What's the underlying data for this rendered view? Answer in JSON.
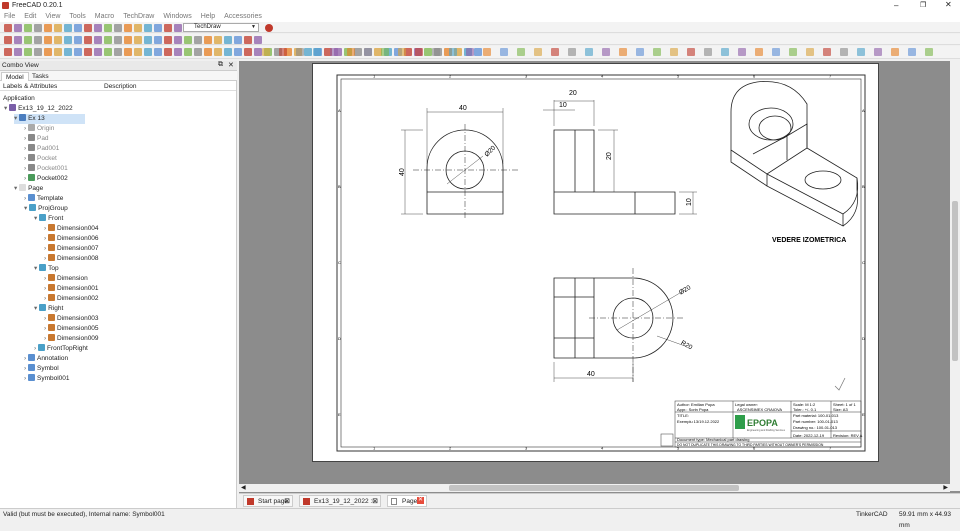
{
  "window": {
    "title": "FreeCAD 0.20.1"
  },
  "menu": [
    "File",
    "Edit",
    "View",
    "Tools",
    "Macro",
    "TechDraw",
    "Windows",
    "Help",
    "Accessories"
  ],
  "workbench": "TechDraw",
  "combo": {
    "title": "Combo View",
    "tabs": [
      "Model",
      "Tasks"
    ],
    "col_labels": "Labels & Attributes",
    "col_desc": "Description",
    "section": "Application"
  },
  "tree": [
    {
      "label": "Ex13_19_12_2022",
      "lvl": 0,
      "color": "#7a5ea8"
    },
    {
      "label": "Ex 13",
      "lvl": 1,
      "color": "#4a7dbf",
      "sel": true
    },
    {
      "label": "Origin",
      "lvl": 2,
      "color": "#aaa",
      "dim": true
    },
    {
      "label": "Pad",
      "lvl": 2,
      "color": "#888",
      "dim": true
    },
    {
      "label": "Pad001",
      "lvl": 2,
      "color": "#888",
      "dim": true
    },
    {
      "label": "Pocket",
      "lvl": 2,
      "color": "#888",
      "dim": true
    },
    {
      "label": "Pocket001",
      "lvl": 2,
      "color": "#888",
      "dim": true
    },
    {
      "label": "Pocket002",
      "lvl": 2,
      "color": "#4a9a5a"
    },
    {
      "label": "Page",
      "lvl": 1,
      "color": "#ddd"
    },
    {
      "label": "Template",
      "lvl": 2,
      "color": "#5a8fd0"
    },
    {
      "label": "ProjGroup",
      "lvl": 2,
      "color": "#4aa0c8"
    },
    {
      "label": "Front",
      "lvl": 3,
      "color": "#4aa0c8"
    },
    {
      "label": "Dimension004",
      "lvl": 4,
      "color": "#c87830"
    },
    {
      "label": "Dimension006",
      "lvl": 4,
      "color": "#c87830"
    },
    {
      "label": "Dimension007",
      "lvl": 4,
      "color": "#c87830"
    },
    {
      "label": "Dimension008",
      "lvl": 4,
      "color": "#c87830"
    },
    {
      "label": "Top",
      "lvl": 3,
      "color": "#4aa0c8"
    },
    {
      "label": "Dimension",
      "lvl": 4,
      "color": "#c87830"
    },
    {
      "label": "Dimension001",
      "lvl": 4,
      "color": "#c87830"
    },
    {
      "label": "Dimension002",
      "lvl": 4,
      "color": "#c87830"
    },
    {
      "label": "Right",
      "lvl": 3,
      "color": "#4aa0c8"
    },
    {
      "label": "Dimension003",
      "lvl": 4,
      "color": "#c87830"
    },
    {
      "label": "Dimension005",
      "lvl": 4,
      "color": "#c87830"
    },
    {
      "label": "Dimension009",
      "lvl": 4,
      "color": "#c87830"
    },
    {
      "label": "FrontTopRight",
      "lvl": 3,
      "color": "#4aa0c8"
    },
    {
      "label": "Annotation",
      "lvl": 2,
      "color": "#5a8fd0"
    },
    {
      "label": "Symbol",
      "lvl": 2,
      "color": "#5a8fd0"
    },
    {
      "label": "Symbol001",
      "lvl": 2,
      "color": "#5a8fd0"
    }
  ],
  "drawing": {
    "dims": {
      "front_w": "40",
      "front_h": "40",
      "front_dia": "Ø20",
      "side_top": "20",
      "side_small": "10",
      "side_h": "20",
      "side_base": "10",
      "top_dia": "Ø20",
      "top_r": "R20",
      "top_w": "40"
    },
    "iso_label": "VEDERE IZOMETRICA",
    "cols": [
      "1",
      "2",
      "3",
      "4",
      "5",
      "6",
      "7"
    ],
    "rows": [
      "A",
      "B",
      "C",
      "D",
      "E"
    ],
    "titleblock": {
      "author": "Author: Emilian Popa",
      "legal": "Legal owner:",
      "owner": "ASCENSIMEX CRAIOVA",
      "scale": "Scale: M 1:2",
      "sheet": "Sheet: 1 of 1",
      "appr": "Appr.: Sorin Popa",
      "toler": "Toler.: +/- 0.1",
      "size": "Size: A3",
      "title_lbl": "TITLE:",
      "title": "Exemplu 13/19.12.2022",
      "part_material": "Part material: 100-01-013",
      "part_number": "Part number: 100-01-013",
      "drawing_no": "Drawing no.: 100-01-013",
      "logo": "EPOPA",
      "logo_sub": "Engineering and Drafting Services",
      "date": "Date: 2022-12-19",
      "revision": "Revision: REV A",
      "doctype": "Document type: Mechanical part drawing",
      "notice": "DO NOT DUPLICATE THIS DRAWING TO THIRD PARTIES WITHOUT OWNER'S PERMISSION"
    }
  },
  "doc_tabs": [
    "Start page",
    "Ex13_19_12_2022 : 1*",
    "Page*"
  ],
  "status": {
    "left": "Valid (but must be executed), Internal name: Symbol001",
    "nav": "TinkerCAD",
    "dims": "59.91 mm x 44.93 mm"
  }
}
